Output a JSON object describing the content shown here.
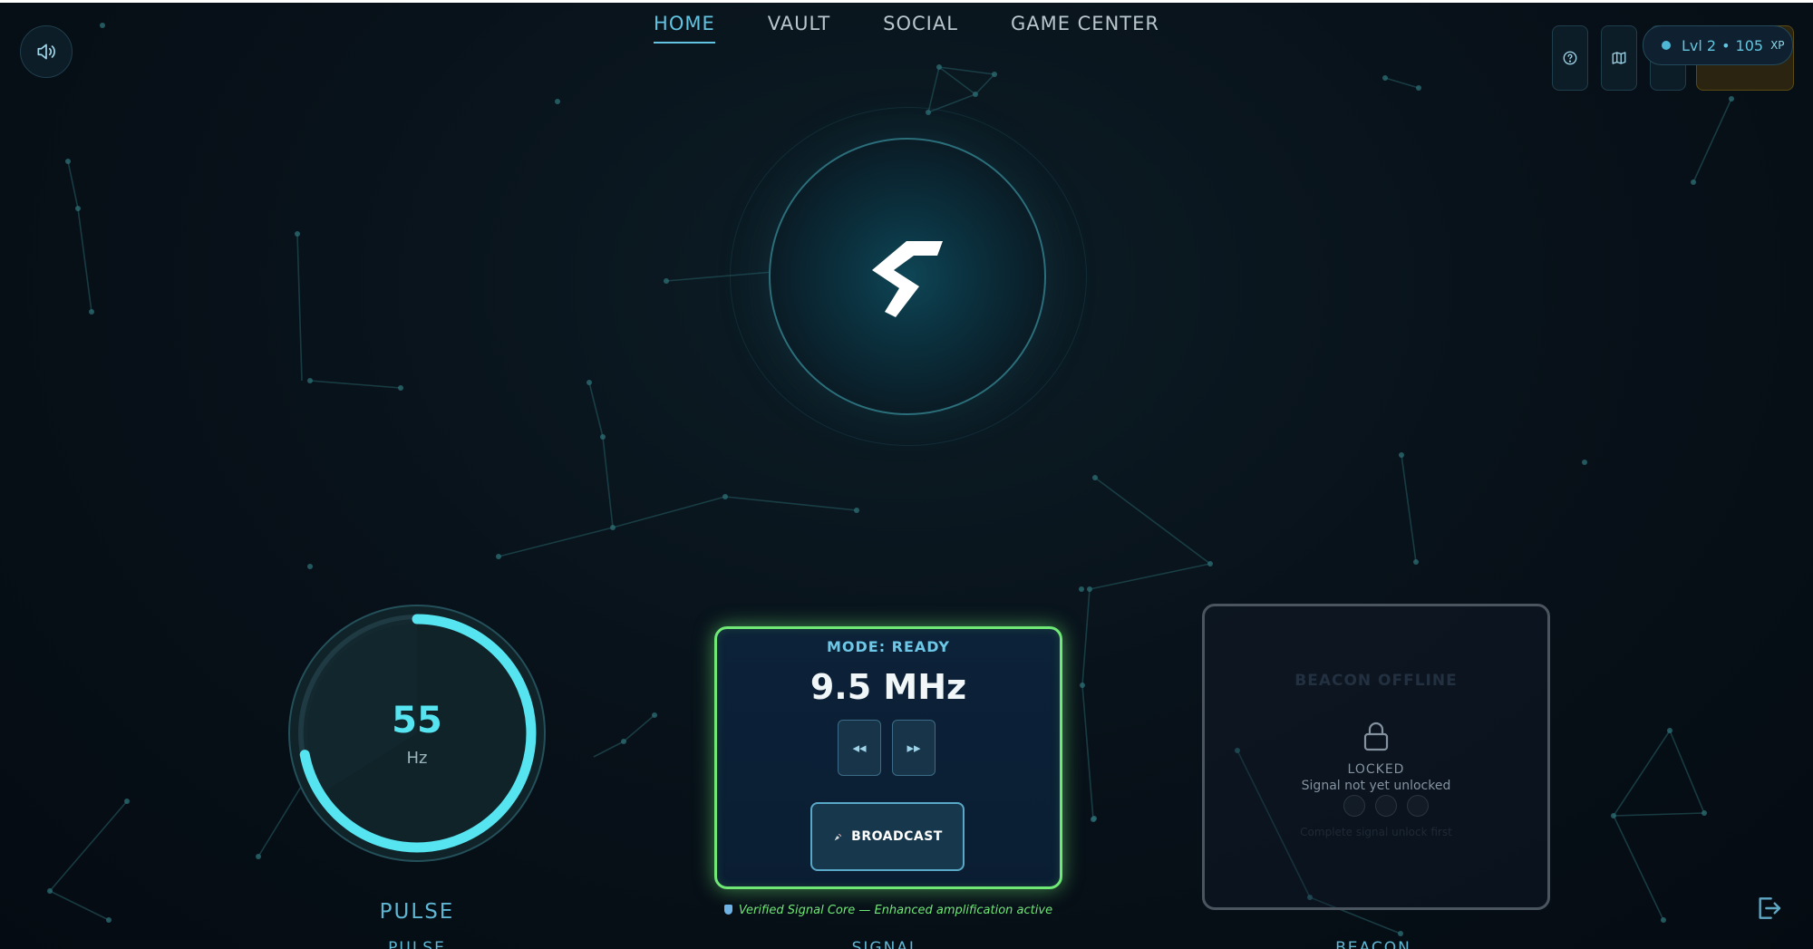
{
  "nav": {
    "tabs": [
      {
        "label": "HOME",
        "active": true
      },
      {
        "label": "VAULT",
        "active": false
      },
      {
        "label": "SOCIAL",
        "active": false
      },
      {
        "label": "GAME CENTER",
        "active": false
      }
    ]
  },
  "header": {
    "sound_icon": "speaker-icon",
    "help_icon": "help-circle-icon",
    "map_icon": "map-icon",
    "logout_icon": "logout-icon"
  },
  "level_badge": {
    "level": "Lvl 2",
    "separator": "•",
    "xp_value": "105",
    "xp_unit": "XP"
  },
  "pulse": {
    "value": "55",
    "unit": "Hz",
    "label": "PULSE",
    "label_cut": "PULSE",
    "dial_fill": 0.72
  },
  "signal": {
    "mode": "MODE: READY",
    "frequency": "9.5 MHz",
    "rewind_glyph": "◂◂",
    "forward_glyph": "▸▸",
    "broadcast_label": "BROADCAST",
    "verified_text": "Verified Signal Core — Enhanced amplification active",
    "label_cut": "SIGNAL"
  },
  "beacon": {
    "title": "BEACON OFFLINE",
    "status": "LOCKED",
    "message": "Signal not yet unlocked",
    "hint": "Complete signal unlock first",
    "label_cut": "BEACON"
  },
  "colors": {
    "accent_cyan": "#56e4f0",
    "nav_active": "#62c3e2",
    "signal_border": "#6fe875",
    "beacon_border": "#4a5560"
  }
}
